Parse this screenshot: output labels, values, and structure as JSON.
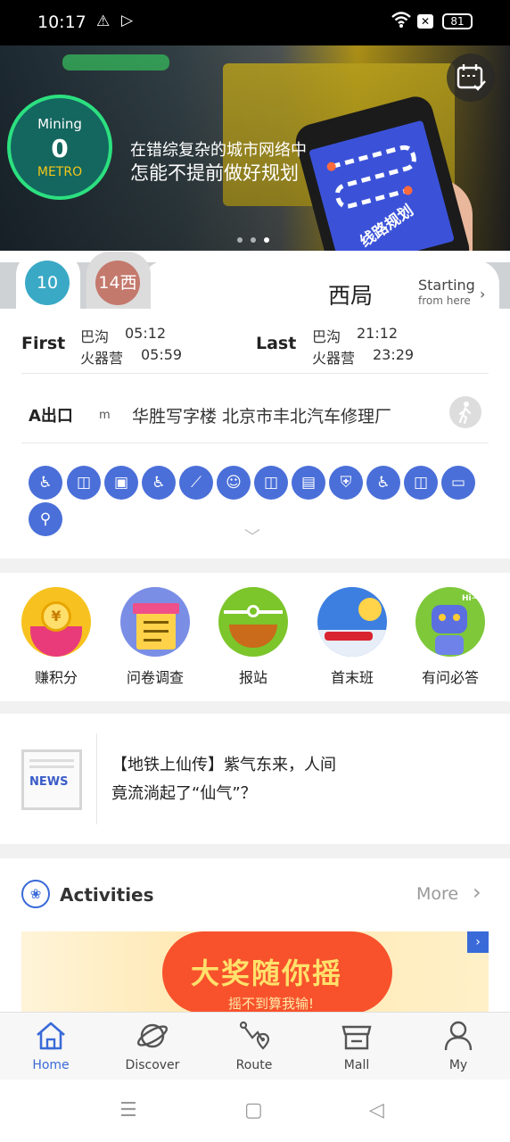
{
  "status_bar": {
    "time": "10:17",
    "battery": "81"
  },
  "banner": {
    "line1": "在错综复杂的城市网络中",
    "line2": "怎能不提前做好规划",
    "phone_label": "线路规划",
    "mining": {
      "label": "Mining",
      "value": "0",
      "unit": "METRO"
    }
  },
  "line_tabs": [
    {
      "label": "10",
      "color": "#3aa9c6"
    },
    {
      "label": "14西",
      "color": "#c4796d"
    }
  ],
  "station": {
    "name": "西局",
    "starting": "Starting",
    "from_here": "from here"
  },
  "first": {
    "label": "First",
    "rows": [
      {
        "dest": "巴沟",
        "time": "05:12"
      },
      {
        "dest": "火器营",
        "time": "05:59"
      }
    ]
  },
  "last": {
    "label": "Last",
    "rows": [
      {
        "dest": "巴沟",
        "time": "21:12"
      },
      {
        "dest": "火器营",
        "time": "23:29"
      }
    ]
  },
  "exit": {
    "name": "A出口",
    "unit": "m",
    "address": "华胜写字楼   北京市丰北汽车修理厂"
  },
  "services": [
    {
      "label": "赚积分"
    },
    {
      "label": "问卷调查"
    },
    {
      "label": "报站"
    },
    {
      "label": "首末班"
    },
    {
      "label": "有问必答"
    }
  ],
  "news": {
    "icon_text": "NEWS",
    "line1": "【地铁上仙传】紫气东来，人间",
    "line2": "竟流淌起了“仙气”？"
  },
  "activities": {
    "title": "Activities",
    "more": "More",
    "promo_title": "大奖随你摇",
    "promo_sub": "摇不到算我输!"
  },
  "tabbar": [
    {
      "label": "Home",
      "icon": "home-icon"
    },
    {
      "label": "Discover",
      "icon": "planet-icon"
    },
    {
      "label": "Route",
      "icon": "route-icon"
    },
    {
      "label": "Mall",
      "icon": "store-icon"
    },
    {
      "label": "My",
      "icon": "user-icon"
    }
  ],
  "colors": {
    "accent": "#3a6ad8",
    "facility": "#4a6fd9"
  }
}
